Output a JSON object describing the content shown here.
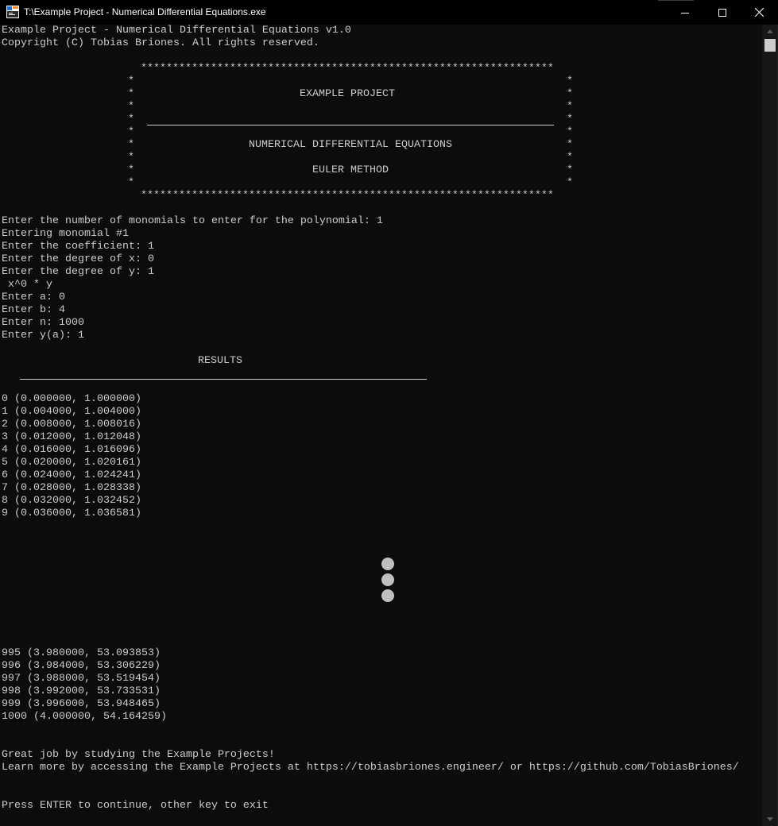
{
  "window": {
    "title": "T:\\Example Project - Numerical Differential Equations.exe",
    "colors": {
      "background": "#0c0c0c",
      "text": "#cccccc",
      "titlebar": "#000000"
    }
  },
  "header": {
    "line1": "Example Project - Numerical Differential Equations v1.0",
    "line2": "Copyright (C) Tobias Briones. All rights reserved."
  },
  "banner": {
    "stars": "*****************************************************************",
    "side": "*",
    "project": "EXAMPLE PROJECT",
    "subject": "NUMERICAL DIFFERENTIAL EQUATIONS",
    "method": "EULER METHOD"
  },
  "prompts": {
    "monomials": "Enter the number of monomials to enter for the polynomial: 1",
    "entering": "Entering monomial #1",
    "coefficient": "Enter the coefficient: 1",
    "degree_x": "Enter the degree of x: 0",
    "degree_y": "Enter the degree of y: 1",
    "polynomial": " x^0 * y",
    "a": "Enter a: 0",
    "b": "Enter b: 4",
    "n": "Enter n: 1000",
    "ya": "Enter y(a): 1"
  },
  "results": {
    "title": "RESULTS",
    "first_rows": [
      "0 (0.000000, 1.000000)",
      "1 (0.004000, 1.004000)",
      "2 (0.008000, 1.008016)",
      "3 (0.012000, 1.012048)",
      "4 (0.016000, 1.016096)",
      "5 (0.020000, 1.020161)",
      "6 (0.024000, 1.024241)",
      "7 (0.028000, 1.028338)",
      "8 (0.032000, 1.032452)",
      "9 (0.036000, 1.036581)"
    ],
    "last_rows": [
      "995 (3.980000, 53.093853)",
      "996 (3.984000, 53.306229)",
      "997 (3.988000, 53.519454)",
      "998 (3.992000, 53.733531)",
      "999 (3.996000, 53.948465)",
      "1000 (4.000000, 54.164259)"
    ]
  },
  "footer": {
    "congrats": "Great job by studying the Example Projects!",
    "learn_more": "Learn more by accessing the Example Projects at https://tobiasbriones.engineer/ or https://github.com/TobiasBriones/",
    "press_enter": "Press ENTER to continue, other key to exit"
  },
  "icons": [
    "console-app-icon",
    "minimize-icon",
    "maximize-icon",
    "close-icon",
    "ellipsis-vertical-icon"
  ]
}
